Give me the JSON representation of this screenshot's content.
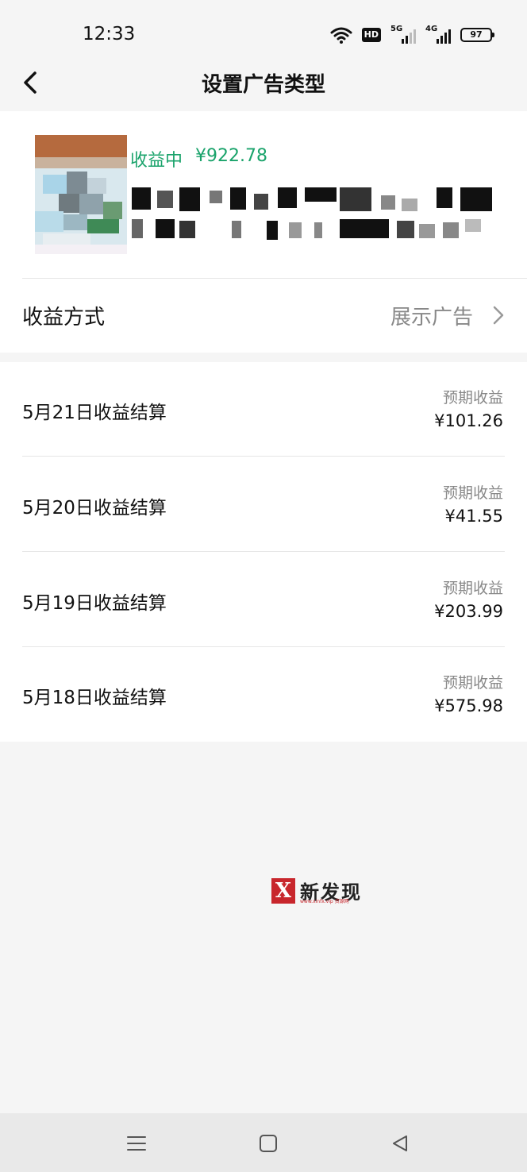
{
  "status_bar": {
    "time": "12:33",
    "hd_label": "HD",
    "net1_label": "5G",
    "net2_label": "4G",
    "battery": "97"
  },
  "header": {
    "title": "设置广告类型",
    "back_icon": "chevron-left-icon"
  },
  "account": {
    "earning_status": "收益中",
    "earning_amount": "¥922.78",
    "earning_color": "#1aa36b"
  },
  "method": {
    "label": "收益方式",
    "value": "展示广告",
    "chevron_icon": "chevron-right-icon"
  },
  "settlements": [
    {
      "title": "5月21日收益结算",
      "sub": "预期收益",
      "amount": "¥101.26"
    },
    {
      "title": "5月20日收益结算",
      "sub": "预期收益",
      "amount": "¥41.55"
    },
    {
      "title": "5月19日收益结算",
      "sub": "预期收益",
      "amount": "¥203.99"
    },
    {
      "title": "5月18日收益结算",
      "sub": "预期收益",
      "amount": "¥575.98"
    }
  ],
  "watermark": {
    "letter": "X",
    "text": "新发现",
    "url": "www.xinfx.vip 资源网"
  },
  "system_nav": {
    "menu_icon": "menu-icon",
    "home_icon": "home-square-icon",
    "back_icon": "back-triangle-icon"
  }
}
